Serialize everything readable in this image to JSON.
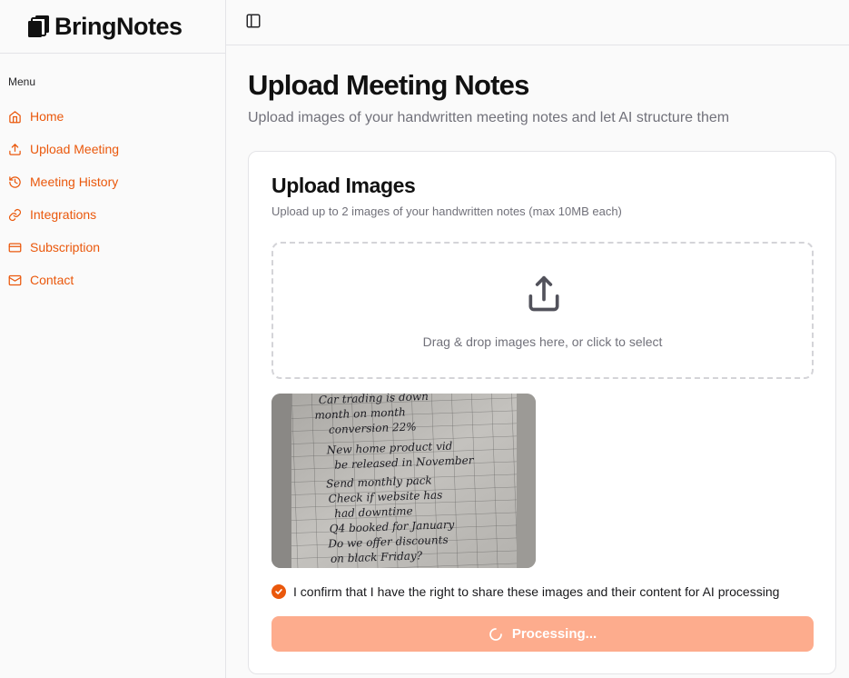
{
  "app": {
    "name": "BringNotes"
  },
  "sidebar": {
    "menu_label": "Menu",
    "items": [
      {
        "label": "Home",
        "icon": "home-icon"
      },
      {
        "label": "Upload Meeting",
        "icon": "upload-icon"
      },
      {
        "label": "Meeting History",
        "icon": "history-icon"
      },
      {
        "label": "Integrations",
        "icon": "link-icon"
      },
      {
        "label": "Subscription",
        "icon": "credit-card-icon"
      },
      {
        "label": "Contact",
        "icon": "mail-icon"
      }
    ]
  },
  "header": {
    "title": "Upload Meeting Notes",
    "subtitle": "Upload images of your handwritten meeting notes and let AI structure them"
  },
  "upload_card": {
    "title": "Upload Images",
    "subtitle": "Upload up to 2 images of your handwritten notes (max 10MB each)",
    "dropzone_text": "Drag & drop images here, or click to select",
    "confirm_text": "I confirm that I have the right to share these images and their content for AI processing",
    "confirm_checked": true,
    "process_button": "Processing..."
  },
  "handwritten_note_lines": [
    "Car trading is down",
    "month on month",
    "conversion 22%",
    "New home product vid",
    "be released in November",
    "Send monthly pack",
    "Check if website has",
    "had downtime",
    "Q4 booked for January",
    "Do we offer discounts",
    "on black Friday?"
  ],
  "colors": {
    "accent": "#ea580c",
    "button_disabled": "#fdac8d",
    "muted_text": "#71717a"
  }
}
